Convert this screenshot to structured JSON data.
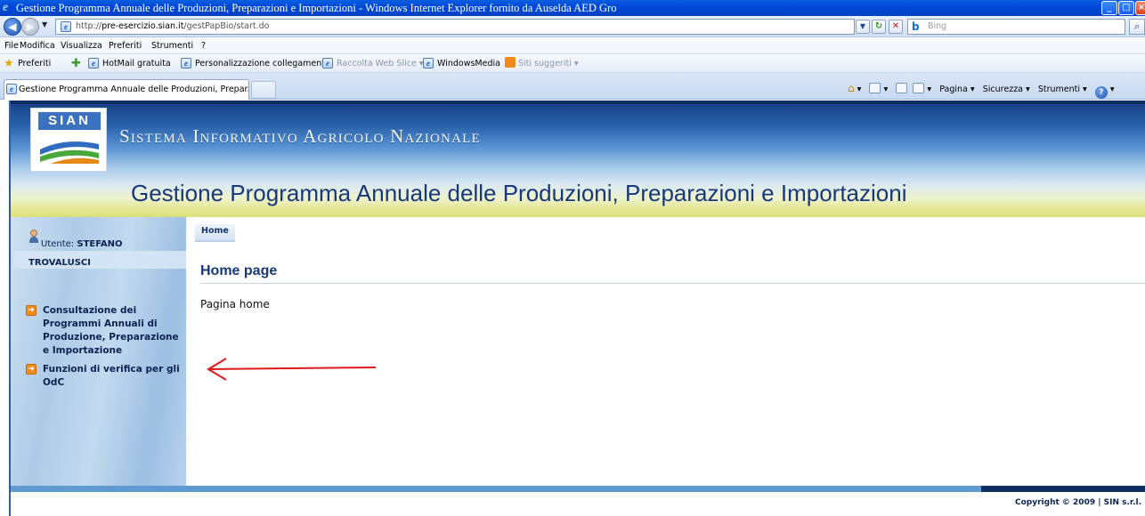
{
  "window": {
    "title": "Gestione Programma Annuale delle Produzioni, Preparazioni e Importazioni - Windows Internet Explorer fornito da Auselda AED Gro"
  },
  "address_bar": {
    "url_prefix": "http://",
    "url_host": "pre-esercizio.sian.it",
    "url_path": "/gestPapBio/start.do",
    "search_placeholder": "Bing"
  },
  "menu": {
    "items": [
      "File",
      "Modifica",
      "Visualizza",
      "Preferiti",
      "Strumenti",
      "?"
    ]
  },
  "favorites_bar": {
    "favorites_label": "Preferiti",
    "items": [
      {
        "label": "HotMail gratuita"
      },
      {
        "label": "Personalizzazione collegamenti"
      },
      {
        "label": "Raccolta Web Slice ▾"
      },
      {
        "label": "WindowsMedia"
      },
      {
        "label": "Siti suggeriti ▾"
      }
    ]
  },
  "tabs": {
    "active_label": "Gestione Programma Annuale delle Produzioni, Prepar..."
  },
  "command_bar": {
    "pagina": "Pagina ▾",
    "sicurezza": "Sicurezza ▾",
    "strumenti": "Strumenti ▾"
  },
  "banner": {
    "logo_text": "SIAN",
    "system_name": "Sistema Informativo Agricolo Nazionale",
    "app_title": "Gestione Programma Annuale delle Produzioni, Preparazioni e Importazioni"
  },
  "sidebar": {
    "user_label": "Utente:",
    "user_first": "STEFANO",
    "user_last": "TROVALUSCI",
    "nav_items": [
      {
        "label": "Consultazione dei Programmi Annuali di Produzione, Preparazione e Importazione"
      },
      {
        "label": "Funzioni di verifica per gli OdC"
      }
    ]
  },
  "main": {
    "breadcrumb": "Home",
    "heading": "Home page",
    "body_text": "Pagina home"
  },
  "footer": {
    "copyright": "Copyright © 2009 | SIN s.r.l."
  },
  "colors": {
    "accent": "#17397c",
    "arrow": "#e01818",
    "bullet": "#ef8a1c"
  }
}
